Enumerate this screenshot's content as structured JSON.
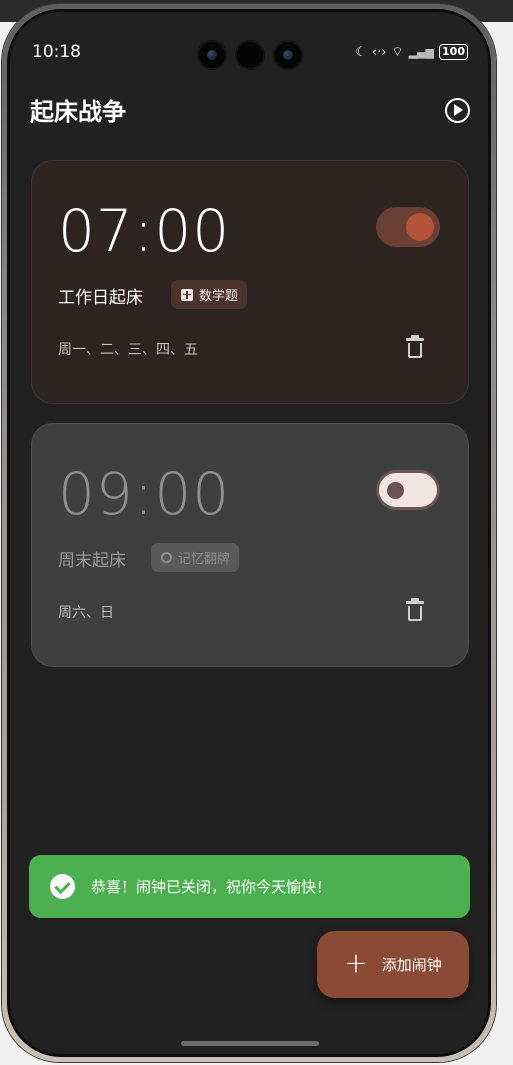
{
  "status_bar": {
    "time": "10:18",
    "battery": "100",
    "icons": [
      "moon-icon",
      "data-arrows-icon",
      "wifi-icon",
      "signal-icon",
      "battery-icon"
    ]
  },
  "header": {
    "title": "起床战争",
    "action_icon": "play-circle-icon"
  },
  "alarms": [
    {
      "time": "07:00",
      "name": "工作日起床",
      "task_label": "数学题",
      "task_icon": "calculator-icon",
      "days": "周一、二、三、四、五",
      "enabled": true
    },
    {
      "time": "09:00",
      "name": "周末起床",
      "task_label": "记忆翻牌",
      "task_icon": "lightbulb-icon",
      "days": "周六、日",
      "enabled": false
    }
  ],
  "toast": {
    "message": "恭喜！闹钟已关闭，祝你今天愉快！",
    "icon": "check-circle-icon"
  },
  "fab": {
    "label": "添加闹钟",
    "icon": "plus-icon"
  },
  "colors": {
    "background": "#212121",
    "accent": "#8b4a35",
    "success": "#4caf50",
    "card_active": "#2d2320",
    "card_inactive": "#3f3f3f"
  }
}
